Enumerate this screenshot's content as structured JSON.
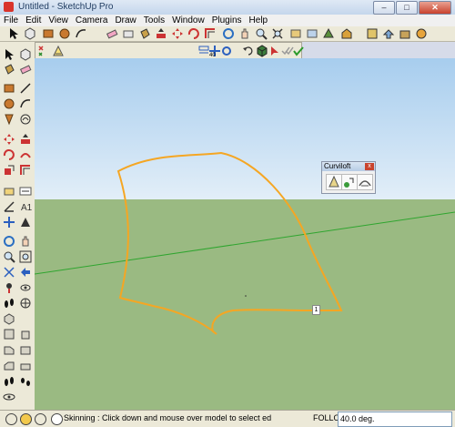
{
  "window": {
    "title": "Untitled - SketchUp Pro",
    "minimize": "‒",
    "maximize": "□",
    "close": "✕"
  },
  "menu": [
    "File",
    "Edit",
    "View",
    "Camera",
    "Draw",
    "Tools",
    "Window",
    "Plugins",
    "Help"
  ],
  "toolbar2": {
    "value": "40"
  },
  "curviloft": {
    "title": "Curviloft",
    "close": "x"
  },
  "viewport": {
    "vertex_label": "1"
  },
  "status": {
    "message": "Skinning : Click down and mouse over model to select edges (see opti",
    "vcb_label": "FOLLOW",
    "vcb_value": "40.0 deg."
  },
  "colors": {
    "sky_top": "#a7cdee",
    "ground": "#9aba82",
    "selection": "#f5a623",
    "axis_green": "#2fa52f"
  }
}
